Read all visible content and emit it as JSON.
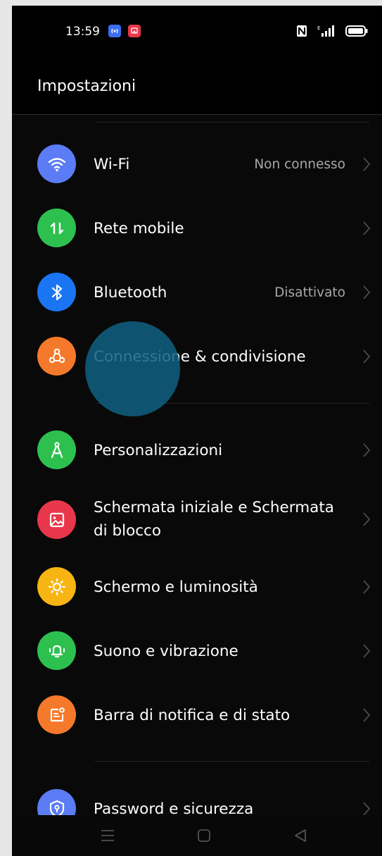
{
  "status_bar": {
    "time": "13:59"
  },
  "header": {
    "title": "Impostazioni"
  },
  "settings": [
    {
      "label": "Wi-Fi",
      "value": "Non connesso",
      "icon": "wifi-icon",
      "color": "#5b7cf5"
    },
    {
      "label": "Rete mobile",
      "value": "",
      "icon": "mobile-data-icon",
      "color": "#2ec04f"
    },
    {
      "label": "Bluetooth",
      "value": "Disattivato",
      "icon": "bluetooth-icon",
      "color": "#1a75f2"
    },
    {
      "label": "Connessione & condivisione",
      "value": "",
      "icon": "connection-sharing-icon",
      "color": "#f5792a"
    },
    {
      "label": "Personalizzazioni",
      "value": "",
      "icon": "personalization-icon",
      "color": "#2ec04f"
    },
    {
      "label": "Schermata iniziale e Schermata di blocco",
      "value": "",
      "icon": "wallpaper-icon",
      "color": "#e8374a"
    },
    {
      "label": "Schermo e luminosità",
      "value": "",
      "icon": "brightness-icon",
      "color": "#f7b514"
    },
    {
      "label": "Suono e vibrazione",
      "value": "",
      "icon": "sound-icon",
      "color": "#2ec04f"
    },
    {
      "label": "Barra di notifica e di stato",
      "value": "",
      "icon": "notification-bar-icon",
      "color": "#f5792a"
    },
    {
      "label": "Password e sicurezza",
      "value": "",
      "icon": "security-icon",
      "color": "#5b7cf5"
    }
  ]
}
